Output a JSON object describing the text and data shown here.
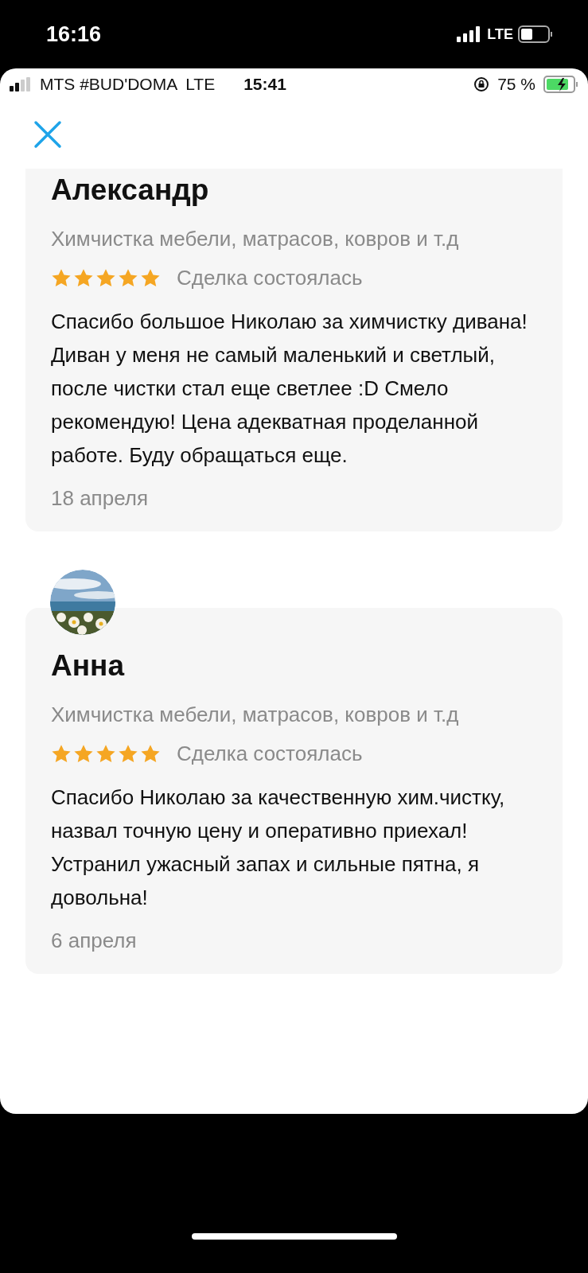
{
  "device_status": {
    "time": "16:16",
    "network": "LTE"
  },
  "app_status": {
    "carrier": "MTS #BUD'DOMA",
    "network": "LTE",
    "time": "15:41",
    "battery": "75 %"
  },
  "reviews": [
    {
      "name": "Александр",
      "service": "Химчистка мебели, матрасов, ковров и т.д",
      "stars": 5,
      "status": "Сделка состоялась",
      "text": "Спасибо большое Николаю за химчистку дивана! Диван у меня не самый маленький и светлый, после чистки стал еще светлее :D Смело рекомендую! Цена адекватная проделанной работе. Буду обращаться еще.",
      "date": "18 апреля"
    },
    {
      "name": "Анна",
      "service": "Химчистка мебели, матрасов, ковров и т.д",
      "stars": 5,
      "status": "Сделка состоялась",
      "text": "Спасибо Николаю за качественную хим.чистку, назвал точную цену и оперативно приехал! Устранил ужасный запах и сильные пятна, я довольна!",
      "date": "6 апреля"
    }
  ]
}
